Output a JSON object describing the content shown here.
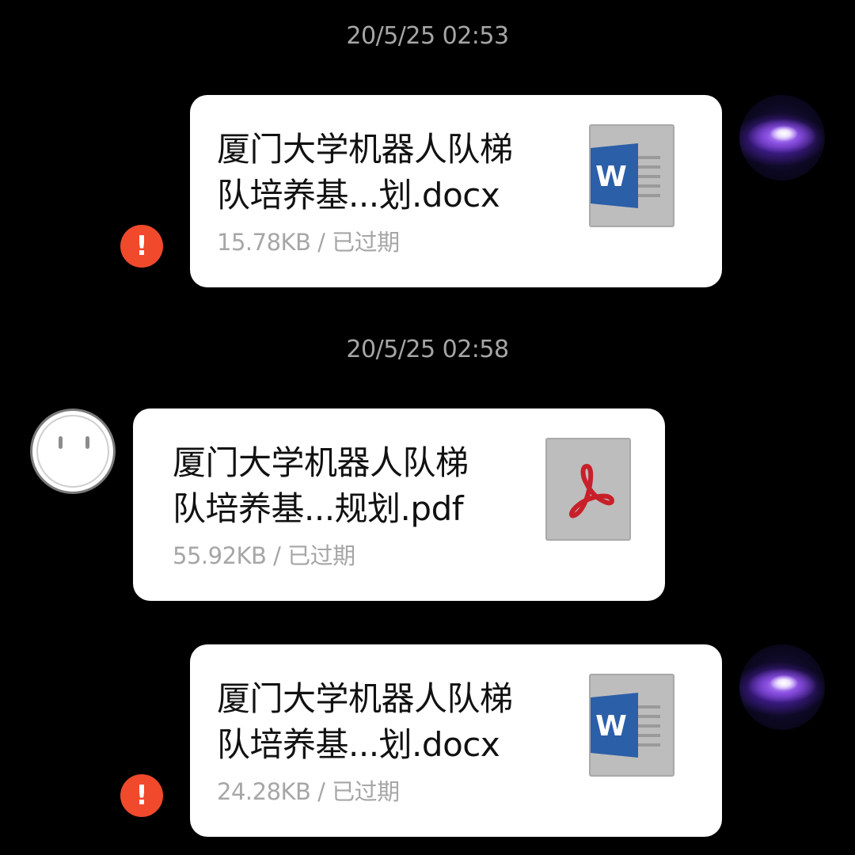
{
  "messages": [
    {
      "timestamp": "20/5/25 02:53",
      "sender": "self",
      "file_name_line1": "厦门大学机器人队梯",
      "file_name_line2": "队培养基...划.docx",
      "file_meta": "15.78KB / 已过期",
      "file_type_icon": "word-doc-icon",
      "status_icon": "error-icon",
      "status_glyph": "!"
    },
    {
      "timestamp": "20/5/25 02:58",
      "sender": "other",
      "file_name_line1": "厦门大学机器人队梯",
      "file_name_line2": "队培养基...规划.pdf",
      "file_meta": "55.92KB / 已过期",
      "file_type_icon": "pdf-icon"
    },
    {
      "sender": "self",
      "file_name_line1": "厦门大学机器人队梯",
      "file_name_line2": "队培养基...划.docx",
      "file_meta": "24.28KB / 已过期",
      "file_type_icon": "word-doc-icon",
      "status_icon": "error-icon",
      "status_glyph": "!"
    }
  ],
  "colors": {
    "background": "#000000",
    "bubble": "#ffffff",
    "timestamp_text": "#a6a6a6",
    "meta_text": "#a6a6a6",
    "error": "#f0492b",
    "word_blue": "#2b5fa8",
    "pdf_red": "#c8202a"
  }
}
